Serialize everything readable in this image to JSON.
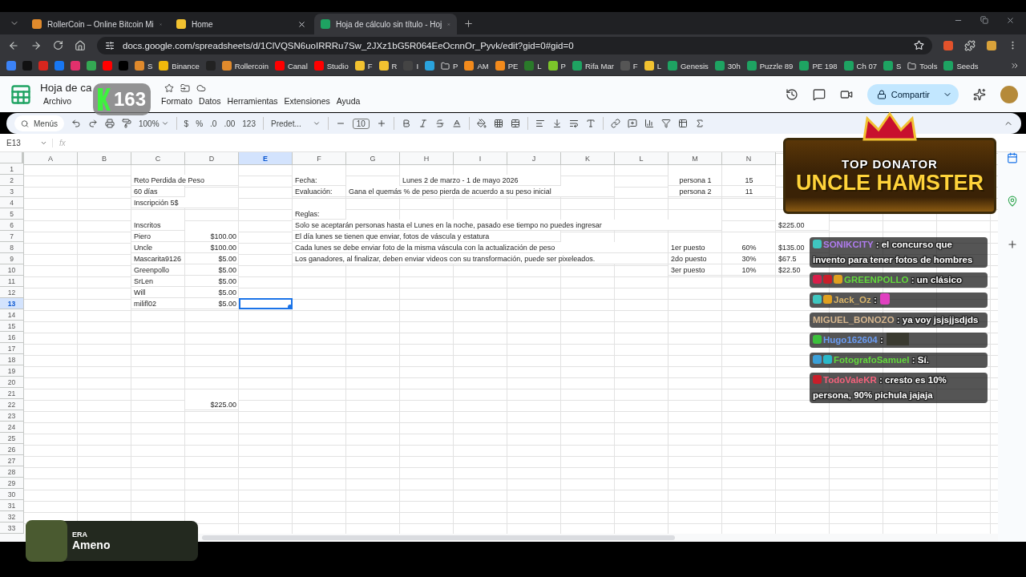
{
  "browser": {
    "tabs": [
      {
        "title": "RollerCoin – Online Bitcoin Mi",
        "selected": false
      },
      {
        "title": "Home",
        "selected": false
      },
      {
        "title": "Hoja de cálculo sin título - Hoj",
        "selected": true
      }
    ],
    "url": "docs.google.com/spreadsheets/d/1ClVQSN6uoIRRRu7Sw_2JXz1bG5R064EeOcnnOr_Pyvk/edit?gid=0#gid=0",
    "bookmarks": [
      {
        "color": "#3b82f6"
      },
      {
        "color": "#111111"
      },
      {
        "color": "#d7261e"
      },
      {
        "color": "#1877f2"
      },
      {
        "color": "#e1306c"
      },
      {
        "color": "#34a853"
      },
      {
        "color": "#ff0000"
      },
      {
        "color": "#000000"
      },
      {
        "label": "S",
        "color": "#e08a2c"
      },
      {
        "label": "Binance",
        "color": "#f0b90b"
      },
      {
        "color": "#222222"
      },
      {
        "label": "Rollercoin",
        "color": "#e08a2c"
      },
      {
        "label": "Canal",
        "color": "#ff0000"
      },
      {
        "label": "Studio",
        "color": "#ff0000"
      },
      {
        "label": "F",
        "color": "#f2c230"
      },
      {
        "label": "R",
        "color": "#f2c230"
      },
      {
        "label": "I",
        "color": "#444444"
      },
      {
        "color": "#2aa3de"
      },
      {
        "label": "P",
        "kind": "folder"
      },
      {
        "label": "AM",
        "color": "#f28a1c"
      },
      {
        "label": "PE",
        "color": "#f28a1c"
      },
      {
        "label": "L",
        "color": "#2a7a2a"
      },
      {
        "label": "P",
        "color": "#7cc52a"
      },
      {
        "label": "Rifa Mar",
        "color": "#1ea362"
      },
      {
        "label": "F",
        "color": "#555555"
      },
      {
        "label": "L",
        "color": "#f2c230"
      },
      {
        "label": "Genesis",
        "color": "#1ea362"
      },
      {
        "label": "30h",
        "color": "#1ea362"
      },
      {
        "label": "Puzzle 89",
        "color": "#1ea362"
      },
      {
        "label": "PE 198",
        "color": "#1ea362"
      },
      {
        "label": "Ch 07",
        "color": "#1ea362"
      },
      {
        "label": "S",
        "color": "#1ea362"
      },
      {
        "label": "Tools",
        "kind": "folder"
      },
      {
        "label": "Seeds",
        "color": "#1ea362"
      }
    ]
  },
  "sheets": {
    "title": "Hoja de ca",
    "menu": [
      "Archivo",
      "Formato",
      "Datos",
      "Herramientas",
      "Extensiones",
      "Ayuda"
    ],
    "share": "Compartir",
    "toolbar": {
      "search": "Menús",
      "zoom": "100%",
      "currency": "$",
      "percent": "%",
      "decrease_decimals": ".0",
      "increase_decimals": ".00",
      "number_format": "123",
      "font": "Predet...",
      "font_size": "10"
    },
    "name_box": "E13",
    "formula_label": "fx",
    "columns": [
      {
        "label": "A",
        "selected": false
      },
      {
        "label": "B",
        "selected": false
      },
      {
        "label": "C",
        "selected": false
      },
      {
        "label": "D",
        "selected": false
      },
      {
        "label": "E",
        "selected": true
      },
      {
        "label": "F",
        "selected": false
      },
      {
        "label": "G",
        "selected": false
      },
      {
        "label": "H",
        "selected": false
      },
      {
        "label": "I",
        "selected": false
      },
      {
        "label": "J",
        "selected": false
      },
      {
        "label": "K",
        "selected": false
      },
      {
        "label": "L",
        "selected": false
      },
      {
        "label": "M",
        "selected": false
      },
      {
        "label": "N",
        "selected": false
      }
    ],
    "rows": [
      {
        "number": "1",
        "selected": false
      },
      {
        "number": "2",
        "selected": false,
        "cells": {
          "c": {
            "text": "Reto Perdida de Peso",
            "kind": "text"
          },
          "f": {
            "text": "Fecha:",
            "kind": "text"
          },
          "h": {
            "text": "Lunes 2 de marzo - 1 de mayo 2026",
            "kind": "text"
          },
          "m": {
            "text": "persona 1",
            "kind": "centered"
          },
          "n": {
            "text": "15",
            "kind": "centered"
          }
        }
      },
      {
        "number": "3",
        "selected": false,
        "cells": {
          "c": {
            "text": "60 días",
            "kind": "text"
          },
          "f": {
            "text": "Evaluación:",
            "kind": "text"
          },
          "g": {
            "text": "Gana el quemás % de peso pierda de acuerdo a su peso inicial",
            "kind": "text"
          },
          "m": {
            "text": "persona 2",
            "kind": "centered"
          },
          "n": {
            "text": "11",
            "kind": "centered"
          }
        }
      },
      {
        "number": "4",
        "selected": false,
        "cells": {
          "c": {
            "text": "Inscripción 5$",
            "kind": "text"
          }
        }
      },
      {
        "number": "5",
        "selected": false,
        "cells": {
          "f": {
            "text": "Reglas:",
            "kind": "text"
          }
        }
      },
      {
        "number": "6",
        "selected": false,
        "cells": {
          "c": {
            "text": "Inscritos",
            "kind": "text"
          },
          "f": {
            "text": "Solo se aceptarán personas hasta el Lunes en la noche, pasado ese tiempo no puedes ingresar",
            "kind": "text"
          },
          "o": {
            "text": "$225.00",
            "kind": "text"
          }
        }
      },
      {
        "number": "7",
        "selected": false,
        "cells": {
          "c": {
            "text": "Piero",
            "kind": "text"
          },
          "d": {
            "text": "$100.00",
            "kind": "number"
          },
          "f": {
            "text": "El día lunes se tienen que enviar, fotos de váscula y estatura",
            "kind": "text"
          }
        }
      },
      {
        "number": "8",
        "selected": false,
        "cells": {
          "c": {
            "text": "Uncle",
            "kind": "text"
          },
          "d": {
            "text": "$100.00",
            "kind": "number"
          },
          "f": {
            "text": "Cada lunes se debe enviar foto de la misma váscula con la actualización de peso",
            "kind": "text"
          },
          "m": {
            "text": "1er puesto",
            "kind": "text"
          },
          "n": {
            "text": "60%",
            "kind": "centered"
          },
          "o": {
            "text": "$135.00",
            "kind": "text"
          }
        }
      },
      {
        "number": "9",
        "selected": false,
        "cells": {
          "c": {
            "text": "Mascarita9126",
            "kind": "text"
          },
          "d": {
            "text": "$5.00",
            "kind": "number"
          },
          "f": {
            "text": "Los ganadores, al finalizar, deben enviar videos con su transformación, puede ser pixeleados.",
            "kind": "text"
          },
          "m": {
            "text": "2do puesto",
            "kind": "text"
          },
          "n": {
            "text": "30%",
            "kind": "centered"
          },
          "o": {
            "text": "$67.5",
            "kind": "text"
          }
        }
      },
      {
        "number": "10",
        "selected": false,
        "cells": {
          "c": {
            "text": "Greenpollo",
            "kind": "text"
          },
          "d": {
            "text": "$5.00",
            "kind": "number"
          },
          "m": {
            "text": "3er puesto",
            "kind": "text"
          },
          "n": {
            "text": "10%",
            "kind": "centered"
          },
          "o": {
            "text": "$22.50",
            "kind": "text"
          }
        }
      },
      {
        "number": "11",
        "selected": false,
        "cells": {
          "c": {
            "text": "SrLen",
            "kind": "text"
          },
          "d": {
            "text": "$5.00",
            "kind": "number"
          }
        }
      },
      {
        "number": "12",
        "selected": false,
        "cells": {
          "c": {
            "text": "Will",
            "kind": "text"
          },
          "d": {
            "text": "$5.00",
            "kind": "number"
          }
        }
      },
      {
        "number": "13",
        "selected": true,
        "cells": {
          "c": {
            "text": "milifl02",
            "kind": "text"
          },
          "d": {
            "text": "$5.00",
            "kind": "number"
          }
        }
      },
      {
        "number": "14",
        "selected": false
      },
      {
        "number": "15",
        "selected": false
      },
      {
        "number": "16",
        "selected": false
      },
      {
        "number": "17",
        "selected": false
      },
      {
        "number": "18",
        "selected": false
      },
      {
        "number": "19",
        "selected": false
      },
      {
        "number": "20",
        "selected": false
      },
      {
        "number": "21",
        "selected": false
      },
      {
        "number": "22",
        "selected": false,
        "cells": {
          "d": {
            "text": "$225.00",
            "kind": "number"
          }
        }
      },
      {
        "number": "23",
        "selected": false
      },
      {
        "number": "24",
        "selected": false
      },
      {
        "number": "25",
        "selected": false
      },
      {
        "number": "26",
        "selected": false
      },
      {
        "number": "27",
        "selected": false
      },
      {
        "number": "28",
        "selected": false
      },
      {
        "number": "29",
        "selected": false
      },
      {
        "number": "30",
        "selected": false
      },
      {
        "number": "31",
        "selected": false
      },
      {
        "number": "32",
        "selected": false
      },
      {
        "number": "33",
        "selected": false
      }
    ]
  },
  "overlays": {
    "subscriber_count": "163",
    "donator": {
      "caption": "TOP DONATOR",
      "name": "UNCLE HAMSTER"
    },
    "chat": [
      {
        "user": "SONIKCITY",
        "color": "#b07cf0",
        "badges": [
          {
            "color": "#3fc7c0"
          }
        ],
        "kind": "text",
        "text": ": el concurso que invento para tener fotos de hombres"
      },
      {
        "user": "GREENPOLLO",
        "color": "#62d83c",
        "badges": [
          {
            "color": "#d81e4a"
          },
          {
            "color": "#c81e2a"
          },
          {
            "color": "#e0a020"
          }
        ],
        "kind": "text",
        "text": ": un clásico"
      },
      {
        "user": "Jack_Oz",
        "color": "#d8b46a",
        "badges": [
          {
            "color": "#3fc7c0"
          },
          {
            "color": "#e0a020"
          }
        ],
        "kind": "emote",
        "text": ":"
      },
      {
        "user": "MIGUEL_BONOZO",
        "color": "#d8b890",
        "kind": "text",
        "text": ": ya voy jsjsjjsdjds"
      },
      {
        "user": "Hugo162604",
        "color": "#6a9cf4",
        "badges": [
          {
            "color": "#3cc03c"
          }
        ],
        "kind": "image",
        "text": ":"
      },
      {
        "user": "FotografoSamuel",
        "color": "#62d83c",
        "badges": [
          {
            "color": "#3aa0d8"
          },
          {
            "color": "#2ab8c8"
          }
        ],
        "kind": "text",
        "text": ": Sí."
      },
      {
        "user": "TodoValeKR",
        "color": "#f4627c",
        "badges": [
          {
            "color": "#c81e2a"
          }
        ],
        "kind": "text",
        "text": ": cresto es 10% persona, 90% pichula jajaja"
      }
    ],
    "now_playing": {
      "artist": "ERA",
      "track": "Ameno"
    }
  }
}
